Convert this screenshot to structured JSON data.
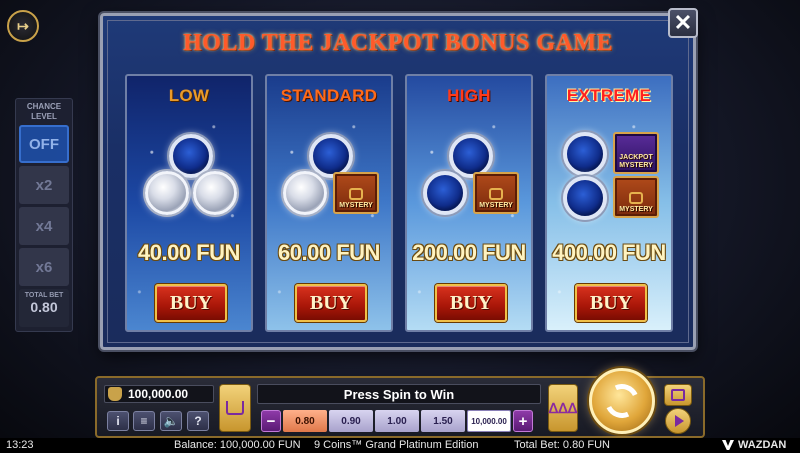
{
  "header": {
    "exit_label": "↦"
  },
  "chance_level": {
    "title": "CHANCE\nLEVEL",
    "options": [
      "OFF",
      "x2",
      "x4",
      "x6"
    ],
    "selected": "OFF",
    "total_bet_label": "TOTAL BET",
    "total_bet_value": "0.80"
  },
  "modal": {
    "title": "HOLD THE JACKPOT BONUS GAME",
    "close_label": "✕",
    "cards": [
      {
        "level": "LOW",
        "price": "40.00 FUN",
        "buy_label": "BUY"
      },
      {
        "level": "STANDARD",
        "price": "60.00 FUN",
        "buy_label": "BUY",
        "tile_label": "MYSTERY"
      },
      {
        "level": "HIGH",
        "price": "200.00 FUN",
        "buy_label": "BUY",
        "tile_label": "MYSTERY"
      },
      {
        "level": "EXTREME",
        "price": "400.00 FUN",
        "buy_label": "BUY",
        "tile_labels": [
          "JACKPOT MYSTERY",
          "MYSTERY"
        ]
      }
    ]
  },
  "controls": {
    "balance": "100,000.00",
    "info_label": "i",
    "menu_label": "≡",
    "sound_label": "🔈",
    "help_label": "?",
    "message": "Press Spin to Win",
    "minus_label": "−",
    "plus_label": "+",
    "bets": [
      "0.80",
      "0.90",
      "1.00",
      "1.50",
      "10,000.00"
    ],
    "selected_bet": "0.80",
    "auto_label": "ᐃᐃᐃ"
  },
  "status_bar": {
    "time": "13:23",
    "balance": "Balance: 100,000.00 FUN",
    "game_name": "9 Coins™ Grand Platinum Edition",
    "total_bet": "Total Bet: 0.80 FUN",
    "brand": "WAZDAN"
  },
  "colors": {
    "title_red": "#ff5a2a",
    "buy_red": "#c8220e",
    "gold": "#c9a24a",
    "active_blue": "#1f4fa8"
  },
  "icons": [
    "exit-icon",
    "close-icon",
    "coin-bag-icon",
    "cart-icon",
    "spin-icon",
    "info-icon",
    "menu-icon",
    "sound-icon",
    "help-icon",
    "play-icon"
  ]
}
